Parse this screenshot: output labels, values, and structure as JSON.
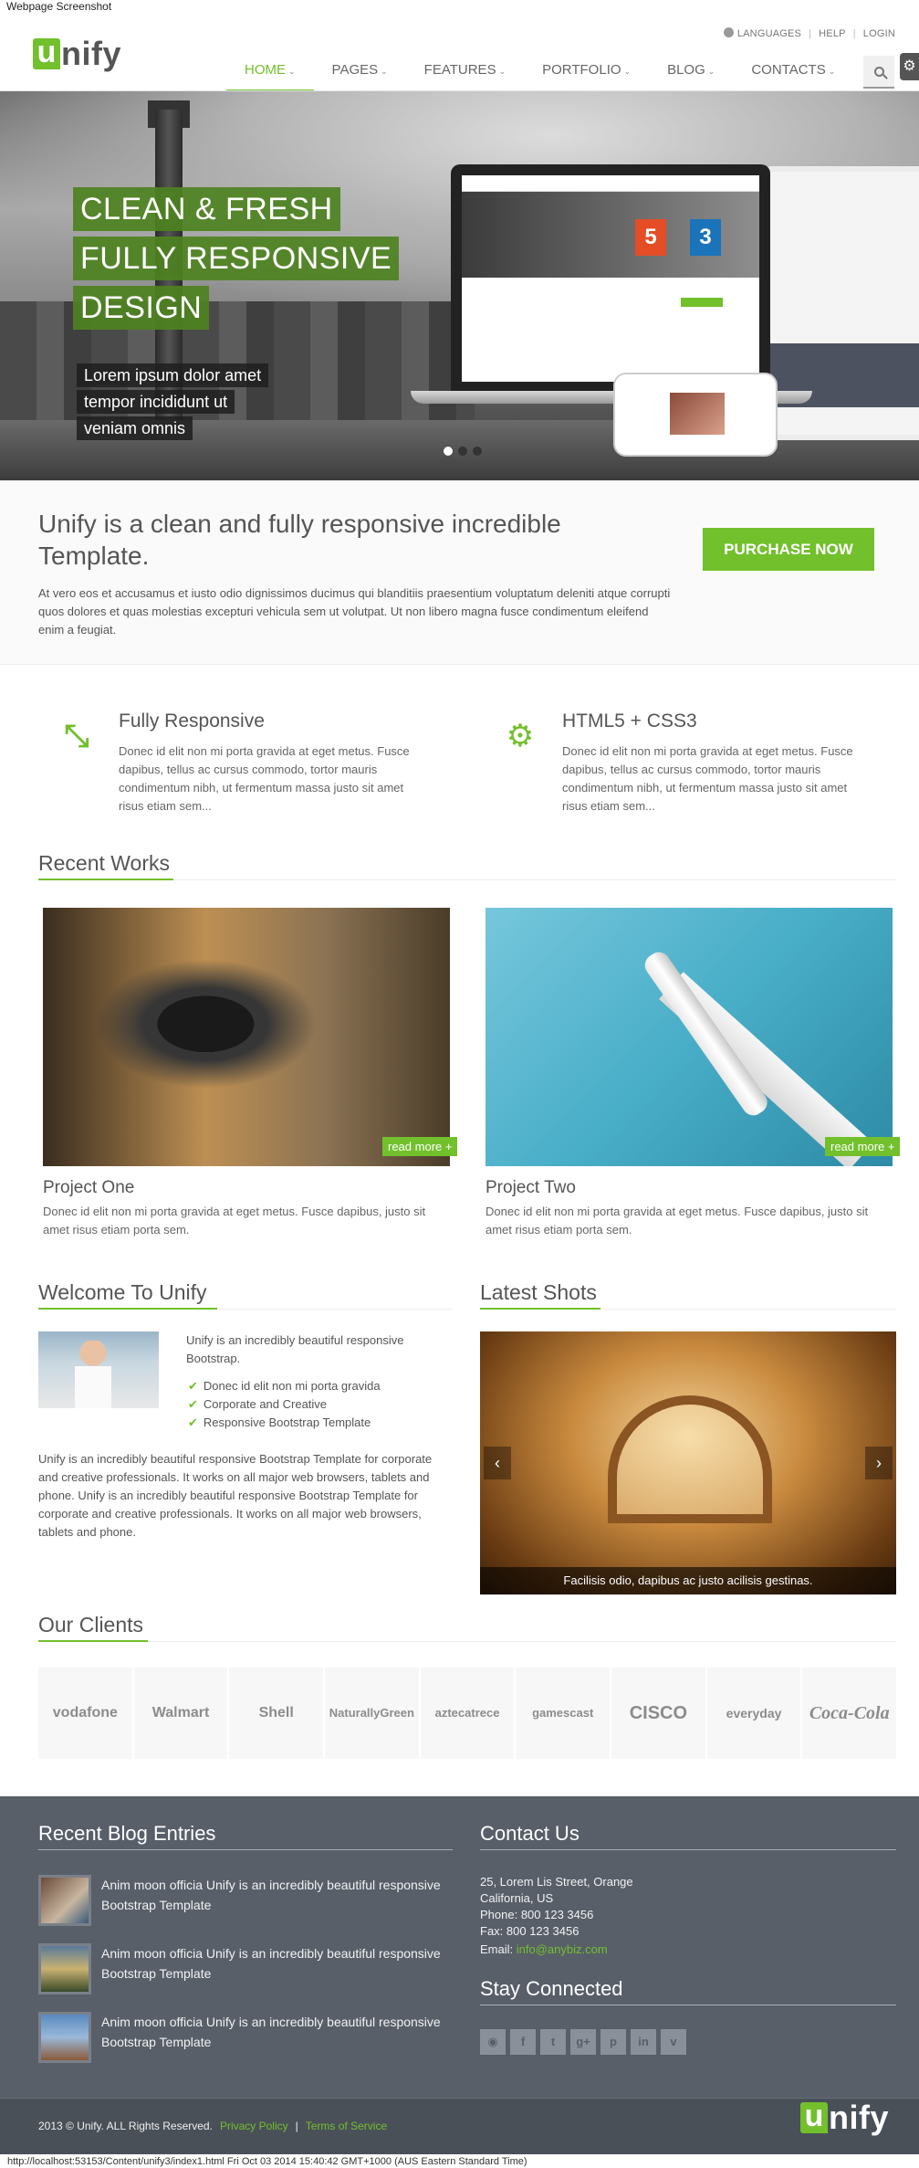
{
  "caption": "Webpage Screenshot",
  "topbar": {
    "languages": "LANGUAGES",
    "help": "HELP",
    "login": "LOGIN",
    "sep1": "|",
    "sep2": "|"
  },
  "logo": {
    "first_letter": "u",
    "rest": "nify"
  },
  "nav": {
    "items": [
      {
        "label": "Home",
        "active": true
      },
      {
        "label": "Pages"
      },
      {
        "label": "Features"
      },
      {
        "label": "Portfolio"
      },
      {
        "label": "Blog"
      },
      {
        "label": "Contacts"
      }
    ],
    "chevron": "⌄"
  },
  "hero": {
    "title_lines": [
      "CLEAN & FRESH",
      "FULLY RESPONSIVE",
      "DESIGN"
    ],
    "sub_lines": [
      "Lorem ipsum dolor amet",
      "tempor incididunt ut",
      "veniam omnis"
    ],
    "html5_glyph": "5",
    "css3_glyph": "3",
    "slide_count": 3,
    "active_slide": 1
  },
  "purchase": {
    "title": "Unify is a clean and fully responsive incredible Template.",
    "text": "At vero eos et accusamus et iusto odio dignissimos ducimus qui blanditiis praesentium voluptatum deleniti atque corrupti quos dolores et quas molestias excepturi vehicula sem ut volutpat. Ut non libero magna fusce condimentum eleifend enim a feugiat.",
    "button": "PURCHASE NOW"
  },
  "features": [
    {
      "title": "Fully Responsive",
      "icon": "compress-arrows-icon",
      "glyph": "⤡",
      "text": "Donec id elit non mi porta gravida at eget metus. Fusce dapibus, tellus ac cursus commodo, tortor mauris condimentum nibh, ut fermentum massa justo sit amet risus etiam sem..."
    },
    {
      "title": "HTML5 + CSS3",
      "icon": "gears-icon",
      "glyph": "⚙",
      "text": "Donec id elit non mi porta gravida at eget metus. Fusce dapibus, tellus ac cursus commodo, tortor mauris condimentum nibh, ut fermentum massa justo sit amet risus etiam sem..."
    }
  ],
  "recent_works": {
    "headline": "Recent Works",
    "items": [
      {
        "title": "Project One",
        "read_more": "read more +",
        "text": "Donec id elit non mi porta gravida at eget metus. Fusce dapibus, justo sit amet risus etiam porta sem."
      },
      {
        "title": "Project Two",
        "read_more": "read more +",
        "text": "Donec id elit non mi porta gravida at eget metus. Fusce dapibus, justo sit amet risus etiam porta sem."
      }
    ]
  },
  "welcome": {
    "headline": "Welcome To Unify",
    "intro": "Unify is an incredibly beautiful responsive Bootstrap.",
    "check": "✔",
    "list": [
      "Donec id elit non mi porta gravida",
      "Corporate and Creative",
      "Responsive Bootstrap Template"
    ],
    "paragraph": "Unify is an incredibly beautiful responsive Bootstrap Template for corporate and creative professionals. It works on all major web browsers, tablets and phone. Unify is an incredibly beautiful responsive Bootstrap Template for corporate and creative professionals. It works on all major web browsers, tablets and phone."
  },
  "latest_shots": {
    "headline": "Latest Shots",
    "caption": "Facilisis odio, dapibus ac justo acilisis gestinas.",
    "prev": "‹",
    "next": "›"
  },
  "clients": {
    "headline": "Our Clients",
    "logos": [
      "vodafone",
      "Walmart",
      "Shell",
      "NaturallyGreen",
      "aztecatrece",
      "gamescast",
      "CISCO",
      "everyday",
      "Coca-Cola"
    ]
  },
  "blog": {
    "headline": "Recent Blog Entries",
    "entries": [
      {
        "text": "Anim moon officia Unify is an incredibly beautiful responsive Bootstrap Template"
      },
      {
        "text": "Anim moon officia Unify is an incredibly beautiful responsive Bootstrap Template"
      },
      {
        "text": "Anim moon officia Unify is an incredibly beautiful responsive Bootstrap Template"
      }
    ]
  },
  "contact": {
    "headline": "Contact Us",
    "address1": "25, Lorem Lis Street, Orange",
    "address2": "California, US",
    "phone": "Phone: 800 123 3456",
    "fax": "Fax: 800 123 3456",
    "email_label": "Email:",
    "email": "info@anybiz.com"
  },
  "stay_connected": {
    "headline": "Stay Connected",
    "icons": [
      {
        "name": "rss-icon",
        "glyph": "◉"
      },
      {
        "name": "facebook-icon",
        "glyph": "f"
      },
      {
        "name": "twitter-icon",
        "glyph": "t"
      },
      {
        "name": "google-plus-icon",
        "glyph": "g+"
      },
      {
        "name": "pinterest-icon",
        "glyph": "p"
      },
      {
        "name": "linkedin-icon",
        "glyph": "in"
      },
      {
        "name": "vimeo-icon",
        "glyph": "v"
      }
    ]
  },
  "footer": {
    "copyright": "2013 © Unify. ALL Rights Reserved.",
    "privacy": "Privacy Policy",
    "sep": "|",
    "terms": "Terms of Service"
  },
  "status_url": "http://localhost:53153/Content/unify3/index1.html Fri Oct 03 2014 15:40:42 GMT+1000 (AUS Eastern Standard Time)",
  "colors": {
    "accent": "#72c02c",
    "footer_bg": "#585f69",
    "text": "#555555"
  }
}
